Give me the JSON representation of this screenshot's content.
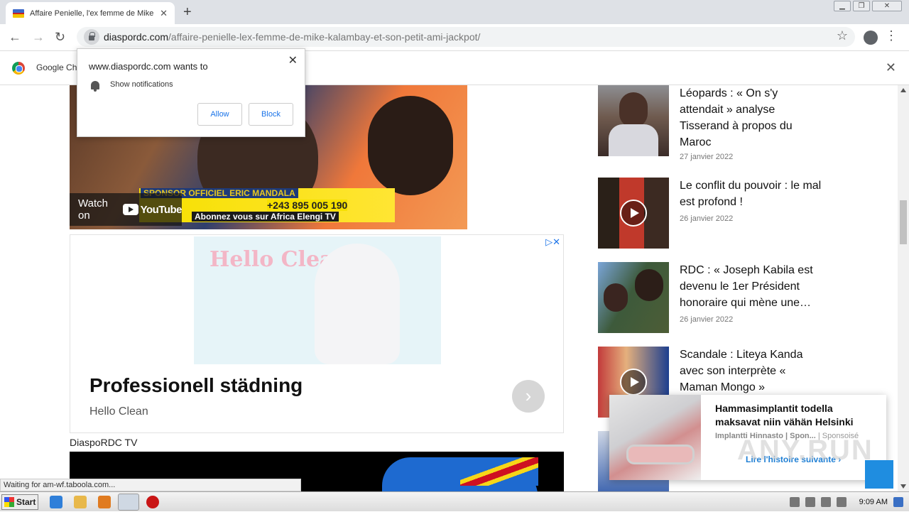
{
  "browser": {
    "tab_title": "Affaire Penielle, l'ex femme de Mike Kalambay et son petit ami jackpot",
    "new_tab": "+",
    "url_domain": "diaspordc.com",
    "url_path": "/affaire-penielle-lex-femme-de-mike-kalambay-et-son-petit-ami-jackpot/",
    "infobar_label": "Google Ch"
  },
  "notification_prompt": {
    "heading": "www.diaspordc.com wants to",
    "permission": "Show notifications",
    "allow": "Allow",
    "block": "Block"
  },
  "video": {
    "watch_on": "Watch on",
    "youtube": "YouTube",
    "sponsor_text": "SPONSOR OFFICIEL ERIC MANDALA",
    "phone": "+243 895 005 190",
    "subscribe_text": "Abonnez vous sur Africa Elengi TV"
  },
  "ad": {
    "brand_image_text": "Hello Clean",
    "headline": "Professionell städning",
    "advertiser": "Hello Clean"
  },
  "section_label": "DiaspoRDC TV",
  "sidebar_news": [
    {
      "title": "Léopards : « On s'y attendait » analyse Tisserand à propos du Maroc",
      "date": "27 janvier 2022"
    },
    {
      "title": "Le conflit du pouvoir : le mal est profond !",
      "date": "26 janvier 2022"
    },
    {
      "title": "RDC : « Joseph Kabila est devenu le 1er Président honoraire qui mène une…",
      "date": "26 janvier 2022"
    },
    {
      "title": "Scandale : Liteya Kanda avec son interprète « Maman Mongo »",
      "date": ""
    }
  ],
  "taboola": {
    "headline": "Hammasimplantit todella maksavat niin vähän Helsinki",
    "source": "Implantti Hinnasto | Spon...",
    "sponsored": "| Sponsoisé",
    "cta": "Lire l'histoire suivante ›",
    "watermark": "ANY.RUN"
  },
  "status_text": "Waiting for am-wf.taboola.com...",
  "taskbar": {
    "start": "Start",
    "clock": "9:09 AM"
  },
  "colors": {
    "link_blue": "#1a73e8",
    "taboola_cta": "#1f7fd4"
  }
}
